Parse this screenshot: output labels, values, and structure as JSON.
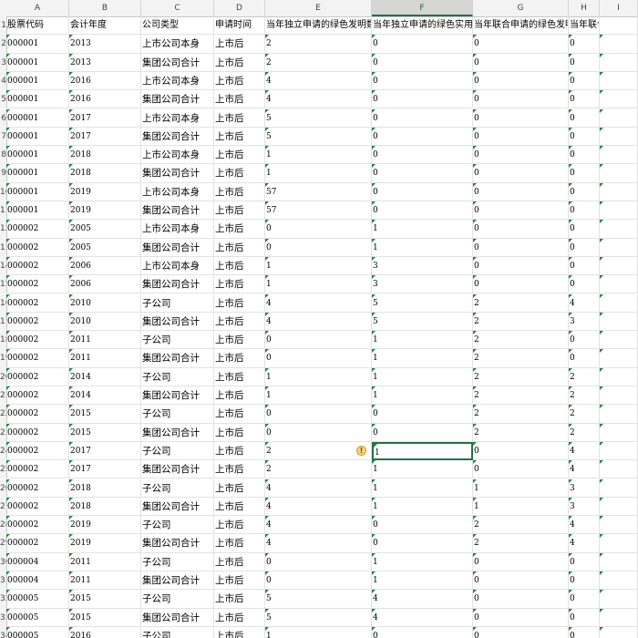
{
  "sheet": {
    "columns": [
      {
        "letter": "A"
      },
      {
        "letter": "B"
      },
      {
        "letter": "C"
      },
      {
        "letter": "D"
      },
      {
        "letter": "E"
      },
      {
        "letter": "F"
      },
      {
        "letter": "G"
      },
      {
        "letter": "H"
      },
      {
        "letter": "I"
      }
    ],
    "selected_column": "F",
    "header_row": {
      "rownum": "1",
      "cells": [
        "股票代码",
        "会计年度",
        "公司类型",
        "申请时间",
        "当年独立申请的绿色发明数量",
        "当年独立申请的绿色实用新型数",
        "当年联合申请的绿色发明数量",
        "当年联合申请的绿色实",
        ""
      ]
    },
    "rows": [
      {
        "n": "2",
        "a": "000001",
        "b": "2013",
        "c": "上市公司本身",
        "d": "上市后",
        "e": "2",
        "f": "0",
        "g": "0",
        "h": "0"
      },
      {
        "n": "3",
        "a": "000001",
        "b": "2013",
        "c": "集团公司合计",
        "d": "上市后",
        "e": "2",
        "f": "0",
        "g": "0",
        "h": "0"
      },
      {
        "n": "4",
        "a": "000001",
        "b": "2016",
        "c": "上市公司本身",
        "d": "上市后",
        "e": "4",
        "f": "0",
        "g": "0",
        "h": "0"
      },
      {
        "n": "5",
        "a": "000001",
        "b": "2016",
        "c": "集团公司合计",
        "d": "上市后",
        "e": "4",
        "f": "0",
        "g": "0",
        "h": "0"
      },
      {
        "n": "6",
        "a": "000001",
        "b": "2017",
        "c": "上市公司本身",
        "d": "上市后",
        "e": "5",
        "f": "0",
        "g": "0",
        "h": "0"
      },
      {
        "n": "7",
        "a": "000001",
        "b": "2017",
        "c": "集团公司合计",
        "d": "上市后",
        "e": "5",
        "f": "0",
        "g": "0",
        "h": "0"
      },
      {
        "n": "8",
        "a": "000001",
        "b": "2018",
        "c": "上市公司本身",
        "d": "上市后",
        "e": "1",
        "f": "0",
        "g": "0",
        "h": "0"
      },
      {
        "n": "9",
        "a": "000001",
        "b": "2018",
        "c": "集团公司合计",
        "d": "上市后",
        "e": "1",
        "f": "0",
        "g": "0",
        "h": "0"
      },
      {
        "n": "10",
        "a": "000001",
        "b": "2019",
        "c": "上市公司本身",
        "d": "上市后",
        "e": "57",
        "f": "0",
        "g": "0",
        "h": "0"
      },
      {
        "n": "11",
        "a": "000001",
        "b": "2019",
        "c": "集团公司合计",
        "d": "上市后",
        "e": "57",
        "f": "0",
        "g": "0",
        "h": "0"
      },
      {
        "n": "12",
        "a": "000002",
        "b": "2005",
        "c": "上市公司本身",
        "d": "上市后",
        "e": "0",
        "f": "1",
        "g": "0",
        "h": "0"
      },
      {
        "n": "13",
        "a": "000002",
        "b": "2005",
        "c": "集团公司合计",
        "d": "上市后",
        "e": "0",
        "f": "1",
        "g": "0",
        "h": "0"
      },
      {
        "n": "14",
        "a": "000002",
        "b": "2006",
        "c": "上市公司本身",
        "d": "上市后",
        "e": "1",
        "f": "3",
        "g": "0",
        "h": "0"
      },
      {
        "n": "15",
        "a": "000002",
        "b": "2006",
        "c": "集团公司合计",
        "d": "上市后",
        "e": "1",
        "f": "3",
        "g": "0",
        "h": "0"
      },
      {
        "n": "16",
        "a": "000002",
        "b": "2010",
        "c": "子公司",
        "d": "上市后",
        "e": "4",
        "f": "5",
        "g": "2",
        "h": "4"
      },
      {
        "n": "17",
        "a": "000002",
        "b": "2010",
        "c": "集团公司合计",
        "d": "上市后",
        "e": "4",
        "f": "5",
        "g": "2",
        "h": "3"
      },
      {
        "n": "18",
        "a": "000002",
        "b": "2011",
        "c": "子公司",
        "d": "上市后",
        "e": "0",
        "f": "1",
        "g": "2",
        "h": "0"
      },
      {
        "n": "19",
        "a": "000002",
        "b": "2011",
        "c": "集团公司合计",
        "d": "上市后",
        "e": "0",
        "f": "1",
        "g": "2",
        "h": "0"
      },
      {
        "n": "20",
        "a": "000002",
        "b": "2014",
        "c": "子公司",
        "d": "上市后",
        "e": "1",
        "f": "1",
        "g": "2",
        "h": "2"
      },
      {
        "n": "21",
        "a": "000002",
        "b": "2014",
        "c": "集团公司合计",
        "d": "上市后",
        "e": "1",
        "f": "1",
        "g": "2",
        "h": "2"
      },
      {
        "n": "22",
        "a": "000002",
        "b": "2015",
        "c": "子公司",
        "d": "上市后",
        "e": "0",
        "f": "0",
        "g": "2",
        "h": "2"
      },
      {
        "n": "23",
        "a": "000002",
        "b": "2015",
        "c": "集团公司合计",
        "d": "上市后",
        "e": "0",
        "f": "0",
        "g": "2",
        "h": "2"
      },
      {
        "n": "24",
        "a": "000002",
        "b": "2017",
        "c": "子公司",
        "d": "上市后",
        "e": "2",
        "f": "1",
        "g": "0",
        "h": "4"
      },
      {
        "n": "25",
        "a": "000002",
        "b": "2017",
        "c": "集团公司合计",
        "d": "上市后",
        "e": "2",
        "f": "1",
        "g": "0",
        "h": "4"
      },
      {
        "n": "26",
        "a": "000002",
        "b": "2018",
        "c": "子公司",
        "d": "上市后",
        "e": "4",
        "f": "1",
        "g": "1",
        "h": "3"
      },
      {
        "n": "27",
        "a": "000002",
        "b": "2018",
        "c": "集团公司合计",
        "d": "上市后",
        "e": "4",
        "f": "1",
        "g": "1",
        "h": "3"
      },
      {
        "n": "28",
        "a": "000002",
        "b": "2019",
        "c": "子公司",
        "d": "上市后",
        "e": "4",
        "f": "0",
        "g": "2",
        "h": "4"
      },
      {
        "n": "29",
        "a": "000002",
        "b": "2019",
        "c": "集团公司合计",
        "d": "上市后",
        "e": "4",
        "f": "0",
        "g": "2",
        "h": "4"
      },
      {
        "n": "30",
        "a": "000004",
        "b": "2011",
        "c": "子公司",
        "d": "上市后",
        "e": "0",
        "f": "1",
        "g": "0",
        "h": "0"
      },
      {
        "n": "31",
        "a": "000004",
        "b": "2011",
        "c": "集团公司合计",
        "d": "上市后",
        "e": "0",
        "f": "1",
        "g": "0",
        "h": "0"
      },
      {
        "n": "32",
        "a": "000005",
        "b": "2015",
        "c": "子公司",
        "d": "上市后",
        "e": "5",
        "f": "4",
        "g": "0",
        "h": "0"
      },
      {
        "n": "33",
        "a": "000005",
        "b": "2015",
        "c": "集团公司合计",
        "d": "上市后",
        "e": "5",
        "f": "4",
        "g": "0",
        "h": "0"
      },
      {
        "n": "34",
        "a": "000005",
        "b": "2016",
        "c": "子公司",
        "d": "上市后",
        "e": "1",
        "f": "0",
        "g": "0",
        "h": "0"
      }
    ],
    "active_cell_row": "24",
    "error_indicator_icon": "warning-diamond-icon",
    "error_indicator_glyph": "!",
    "accent_color": "#217346"
  }
}
